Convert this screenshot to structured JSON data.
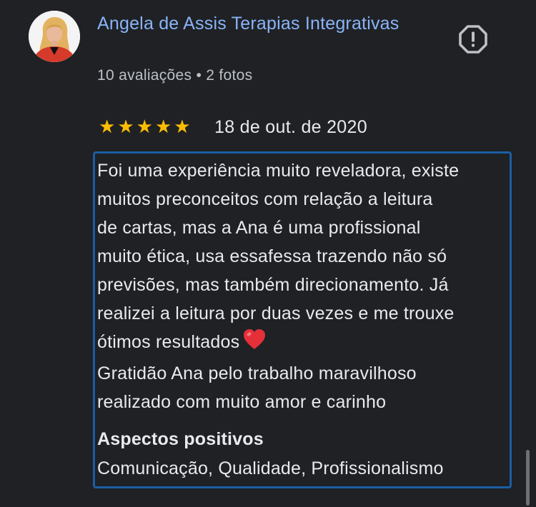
{
  "review": {
    "author_name": "Angela de Assis Terapias Integrativas",
    "author_meta": "10 avaliações • 2 fotos",
    "rating": 5,
    "rating_max": 5,
    "star_glyph": "★",
    "date": "18 de out. de 2020",
    "text_lines": [
      "Foi uma experiência muito reveladora, existe",
      "muitos preconceitos com relação a leitura",
      "de cartas, mas a Ana é uma profissional",
      "muito ética, usa essafessa trazendo não só",
      "previsões, mas também direcionamento. Já",
      "realizei a leitura por duas vezes e me trouxe",
      "ótimos resultados",
      "Gratidão Ana pelo trabalho maravilhoso",
      "realizado com muito amor e carinho"
    ],
    "aspects_title": "Aspectos positivos",
    "aspects_values": "Comunicação, Qualidade, Profissionalismo"
  },
  "icons": {
    "report": "report-flag-icon",
    "heart": "red-heart-emoji"
  },
  "colors": {
    "background": "#1f2125",
    "author_link": "#8ab4f8",
    "star": "#fbbc04",
    "highlight_border": "#1b5ea3",
    "text": "#e8eaed",
    "meta_text": "#bdc1c6",
    "heart": "#e5303a"
  }
}
